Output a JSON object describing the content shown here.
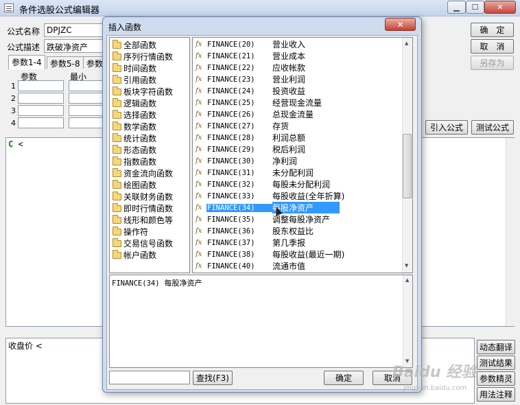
{
  "main": {
    "title": "条件选股公式编辑器",
    "formula_name_label": "公式名称",
    "formula_name_value": "DPJZC",
    "formula_desc_label": "公式描述",
    "formula_desc_value": "跌破净资产",
    "tabs": [
      "参数1-4",
      "参数5-8",
      "参数"
    ],
    "param_header": "参数",
    "min_header": "最小",
    "row_numbers": [
      "1",
      "2",
      "3",
      "4"
    ],
    "buttons": {
      "confirm": "确　定",
      "cancel": "取　消",
      "save_as": "另存为",
      "import_formula": "引入公式",
      "test_formula": "测试公式"
    },
    "editor_keyword": "C",
    "editor_rest": " <",
    "output_text": "收盘价 <",
    "side_buttons": [
      "动态翻译",
      "测试结果",
      "参数精灵",
      "用法注释"
    ]
  },
  "dialog": {
    "title": "插入函数",
    "close_label": "✕",
    "categories": [
      "全部函数",
      "序列行情函数",
      "时间函数",
      "引用函数",
      "板块字符函数",
      "逻辑函数",
      "选择函数",
      "数学函数",
      "统计函数",
      "形态函数",
      "指数函数",
      "资金流向函数",
      "绘图函数",
      "关联财务函数",
      "即时行情函数",
      "线形和颜色等",
      "操作符",
      "交易信号函数",
      "帐户函数"
    ],
    "functions": [
      {
        "code": "FINANCE(20)",
        "desc": "营业收入"
      },
      {
        "code": "FINANCE(21)",
        "desc": "营业成本"
      },
      {
        "code": "FINANCE(22)",
        "desc": "应收帐款"
      },
      {
        "code": "FINANCE(23)",
        "desc": "营业利润"
      },
      {
        "code": "FINANCE(24)",
        "desc": "投资收益"
      },
      {
        "code": "FINANCE(25)",
        "desc": "经营现金流量"
      },
      {
        "code": "FINANCE(26)",
        "desc": "总现金流量"
      },
      {
        "code": "FINANCE(27)",
        "desc": "存货"
      },
      {
        "code": "FINANCE(28)",
        "desc": "利润总额"
      },
      {
        "code": "FINANCE(29)",
        "desc": "税后利润"
      },
      {
        "code": "FINANCE(30)",
        "desc": "净利润"
      },
      {
        "code": "FINANCE(31)",
        "desc": "未分配利润"
      },
      {
        "code": "FINANCE(32)",
        "desc": "每股未分配利润"
      },
      {
        "code": "FINANCE(33)",
        "desc": "每股收益(全年折算)"
      },
      {
        "code": "FINANCE(34)",
        "desc": "每股净资产"
      },
      {
        "code": "FINANCE(35)",
        "desc": "调整每股净资产"
      },
      {
        "code": "FINANCE(36)",
        "desc": "股东权益比"
      },
      {
        "code": "FINANCE(37)",
        "desc": "第几季报"
      },
      {
        "code": "FINANCE(38)",
        "desc": "每股收益(最近一期)"
      },
      {
        "code": "FINANCE(40)",
        "desc": "流通市值"
      }
    ],
    "selected_index": 14,
    "fx_label": "fx",
    "description_code": "FINANCE(34)",
    "description_text": "每股净资产",
    "search_value": "",
    "find_button": "查找(F3)",
    "ok_button": "确定",
    "cancel_button": "取消"
  },
  "watermark": {
    "text": "Baidu 经验",
    "sub": "jingyan.baidu.com"
  },
  "colors": {
    "selection": "#3399ff",
    "keyword": "#008000",
    "close_button": "#c4402f"
  }
}
